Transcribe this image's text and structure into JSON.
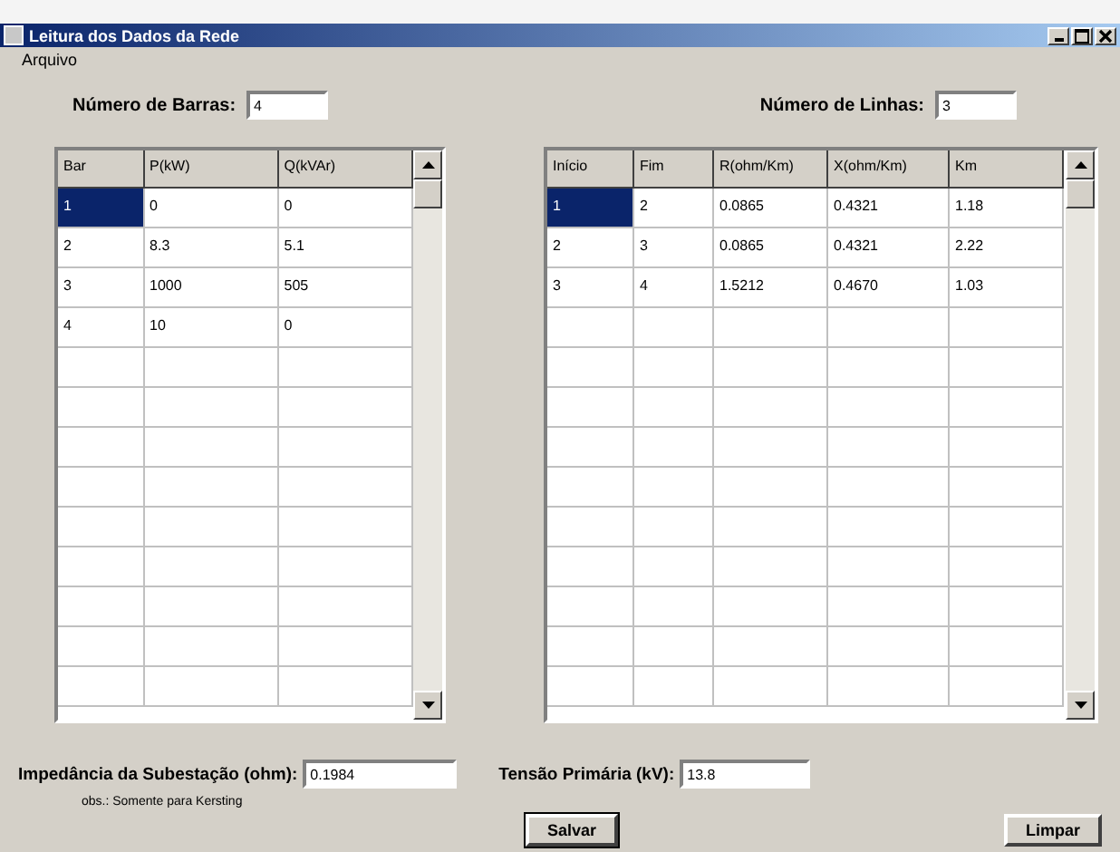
{
  "window": {
    "title": "Leitura dos Dados da Rede"
  },
  "menu": [
    {
      "label": "Arquivo"
    }
  ],
  "buses": {
    "label": "Número de Barras:",
    "value": "4",
    "columns": [
      "Bar",
      "P(kW)",
      "Q(kVAr)"
    ],
    "rows": [
      {
        "cells": [
          "1",
          "0",
          "0"
        ],
        "selected": true
      },
      {
        "cells": [
          "2",
          "8.3",
          "5.1"
        ],
        "selected": false
      },
      {
        "cells": [
          "3",
          "1000",
          "505"
        ],
        "selected": false
      },
      {
        "cells": [
          "4",
          "10",
          "0"
        ],
        "selected": false
      }
    ]
  },
  "lines": {
    "label": "Número de Linhas:",
    "value": "3",
    "columns": [
      "Início",
      "Fim",
      "R(ohm/Km)",
      "X(ohm/Km)",
      "Km"
    ],
    "rows": [
      {
        "cells": [
          "1",
          "2",
          "0.0865",
          "0.4321",
          "1.18"
        ],
        "selected": true
      },
      {
        "cells": [
          "2",
          "3",
          "0.0865",
          "0.4321",
          "2.22"
        ],
        "selected": false
      },
      {
        "cells": [
          "3",
          "4",
          "1.5212",
          "0.4670",
          "1.03"
        ],
        "selected": false
      }
    ]
  },
  "impedance": {
    "label": "Impedância da Subestação (ohm):",
    "value": "0.1984"
  },
  "voltage": {
    "label": "Tensão Primária (kV):",
    "value": "13.8"
  },
  "note": "obs.: Somente para Kersting",
  "buttons": [
    "Salvar",
    "Limpar"
  ]
}
